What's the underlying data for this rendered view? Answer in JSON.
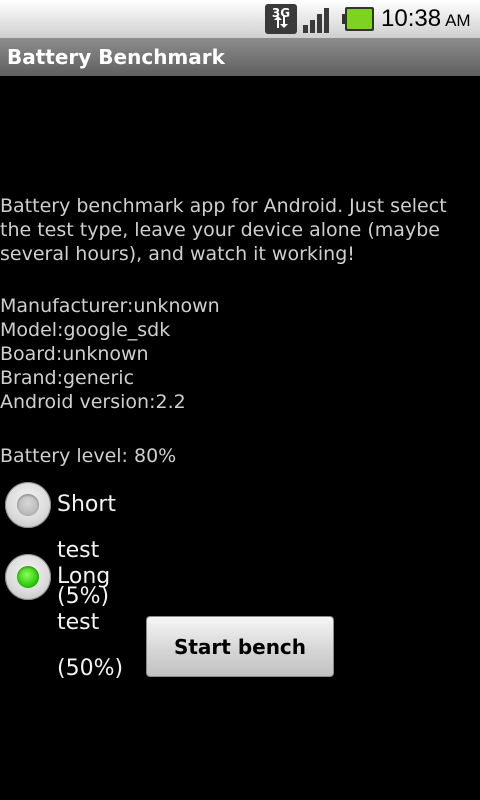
{
  "status_bar": {
    "network": "3G",
    "time": "10:38",
    "ampm": "AM"
  },
  "app": {
    "title": "Battery Benchmark"
  },
  "description": "Battery benchmark app for Android. Just select the test type, leave your device alone (maybe several hours), and watch it working!",
  "device_info": {
    "manufacturer": "Manufacturer:unknown",
    "model": "Model:google_sdk",
    "board": "Board:unknown",
    "brand": "Brand:generic",
    "android_version": "Android version:2.2"
  },
  "battery_level": "Battery level: 80%",
  "options": {
    "short": {
      "label": "Short test (5%)",
      "checked": false
    },
    "long": {
      "label": "Long test (50%)",
      "checked": true
    }
  },
  "start_button": "Start bench",
  "colors": {
    "radio_checked": "#20c000",
    "background": "#000000",
    "title_bar": "#7a7a7a"
  }
}
